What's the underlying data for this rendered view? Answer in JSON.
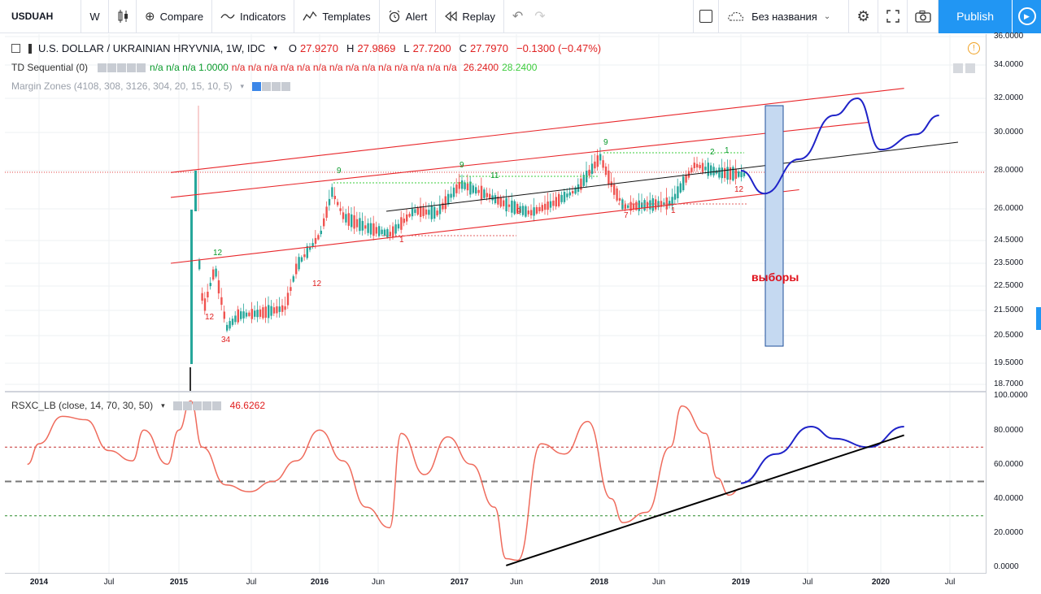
{
  "toolbar": {
    "symbol": "USDUAH",
    "interval": "W",
    "compare_label": "Compare",
    "indicators_label": "Indicators",
    "templates_label": "Templates",
    "alert_label": "Alert",
    "replay_label": "Replay",
    "layout_name": "Без названия",
    "publish_label": "Publish"
  },
  "legend": {
    "title": "U.S. DOLLAR / UKRAINIAN HRYVNIA, 1W, IDC",
    "o_label": "O",
    "o_value": "27.9270",
    "h_label": "H",
    "h_value": "27.9869",
    "l_label": "L",
    "l_value": "27.7200",
    "c_label": "C",
    "c_value": "27.7970",
    "change": "−0.1300 (−0.47%)",
    "td_name": "TD Sequential (0)",
    "td_values_green": "n/a n/a n/a 1.0000",
    "td_values_red": "n/a n/a n/a n/a n/a n/a n/a n/a n/a n/a n/a n/a n/a n/a",
    "td_val_1": "26.2400",
    "td_val_2": "28.2400",
    "mz_name": "Margin Zones (4108, 308, 3126, 304, 20, 15, 10, 5)",
    "rsx_name": "RSXC_LB (close, 14, 70, 30, 50)",
    "rsx_value": "46.6262"
  },
  "annotation": "выборы",
  "price_axis": [
    "36.0000",
    "34.0000",
    "32.0000",
    "30.0000",
    "28.0000",
    "26.0000",
    "24.5000",
    "23.5000",
    "22.5000",
    "21.5000",
    "20.5000",
    "19.5000",
    "18.7000"
  ],
  "osc_axis": [
    "100.0000",
    "80.0000",
    "60.0000",
    "40.0000",
    "20.0000",
    "0.0000"
  ],
  "time_axis": [
    {
      "label": "2014",
      "year": true
    },
    {
      "label": "Jul",
      "year": false
    },
    {
      "label": "2015",
      "year": true
    },
    {
      "label": "Jul",
      "year": false
    },
    {
      "label": "2016",
      "year": true
    },
    {
      "label": "Jun",
      "year": false
    },
    {
      "label": "2017",
      "year": true
    },
    {
      "label": "Jun",
      "year": false
    },
    {
      "label": "2018",
      "year": true
    },
    {
      "label": "Jun",
      "year": false
    },
    {
      "label": "2019",
      "year": true
    },
    {
      "label": "Jul",
      "year": false
    },
    {
      "label": "2020",
      "year": true
    },
    {
      "label": "Jul",
      "year": false
    }
  ],
  "colors": {
    "up_candle": "#26a69a",
    "down_candle": "#ef5350",
    "channel": "#e8262a",
    "forecast": "#1f23c8",
    "rsx_line": "#ef6b5c",
    "accent": "#2196f3"
  },
  "chart_data": [
    {
      "type": "candlestick",
      "title": "U.S. DOLLAR / UKRAINIAN HRYVNIA, 1W, IDC",
      "close_path": [
        [
          "2015-01",
          19.4
        ],
        [
          "2015-02",
          27.8
        ],
        [
          "2015-03",
          21.5
        ],
        [
          "2015-04",
          23.3
        ],
        [
          "2015-05",
          20.8
        ],
        [
          "2015-06",
          21.3
        ],
        [
          "2015-08",
          21.4
        ],
        [
          "2015-10",
          21.6
        ],
        [
          "2015-11",
          23.4
        ],
        [
          "2016-01",
          24.8
        ],
        [
          "2016-02",
          26.9
        ],
        [
          "2016-03",
          25.6
        ],
        [
          "2016-05",
          25.1
        ],
        [
          "2016-07",
          24.8
        ],
        [
          "2016-09",
          25.9
        ],
        [
          "2016-11",
          25.8
        ],
        [
          "2017-01",
          27.3
        ],
        [
          "2017-03",
          26.8
        ],
        [
          "2017-05",
          26.2
        ],
        [
          "2017-07",
          25.8
        ],
        [
          "2017-09",
          26.3
        ],
        [
          "2017-11",
          27.0
        ],
        [
          "2018-01",
          28.7
        ],
        [
          "2018-02",
          27.2
        ],
        [
          "2018-03",
          26.1
        ],
        [
          "2018-05",
          26.2
        ],
        [
          "2018-07",
          26.3
        ],
        [
          "2018-09",
          28.3
        ],
        [
          "2018-11",
          27.9
        ],
        [
          "2019-01",
          27.8
        ]
      ],
      "channel_lines": [
        {
          "from": [
            "2015-01",
            27.9
          ],
          "to": [
            "2020-03",
            32.6
          ]
        },
        {
          "from": [
            "2015-01",
            26.6
          ],
          "to": [
            "2019-12",
            30.6
          ]
        },
        {
          "from": [
            "2015-01",
            23.5
          ],
          "to": [
            "2019-06",
            27.0
          ]
        }
      ],
      "forecast": [
        [
          "2019-01",
          28.0
        ],
        [
          "2019-03",
          26.8
        ],
        [
          "2019-06",
          28.6
        ],
        [
          "2019-09",
          31.0
        ],
        [
          "2019-11",
          32.0
        ],
        [
          "2020-01",
          29.1
        ],
        [
          "2020-04",
          29.9
        ],
        [
          "2020-06",
          31.0
        ]
      ],
      "event_zone": {
        "from": "2019-03",
        "to": "2019-05",
        "label": "выборы"
      }
    },
    {
      "type": "line",
      "title": "RSXC_LB (close, 14, 70, 30, 50)",
      "ylim": [
        0,
        100
      ],
      "levels": [
        70,
        50,
        30
      ],
      "values": [
        [
          "2013-12",
          60
        ],
        [
          "2014-01",
          72
        ],
        [
          "2014-03",
          88
        ],
        [
          "2014-05",
          86
        ],
        [
          "2014-07",
          68
        ],
        [
          "2014-09",
          62
        ],
        [
          "2014-10",
          80
        ],
        [
          "2014-12",
          60
        ],
        [
          "2015-01",
          80
        ],
        [
          "2015-02",
          97
        ],
        [
          "2015-03",
          70
        ],
        [
          "2015-05",
          48
        ],
        [
          "2015-07",
          44
        ],
        [
          "2015-09",
          50
        ],
        [
          "2015-11",
          62
        ],
        [
          "2016-01",
          80
        ],
        [
          "2016-03",
          62
        ],
        [
          "2016-05",
          35
        ],
        [
          "2016-07",
          23
        ],
        [
          "2016-08",
          78
        ],
        [
          "2016-10",
          54
        ],
        [
          "2016-12",
          76
        ],
        [
          "2017-02",
          60
        ],
        [
          "2017-04",
          35
        ],
        [
          "2017-05",
          5
        ],
        [
          "2017-06",
          4
        ],
        [
          "2017-08",
          72
        ],
        [
          "2017-10",
          66
        ],
        [
          "2017-12",
          85
        ],
        [
          "2018-02",
          40
        ],
        [
          "2018-03",
          26
        ],
        [
          "2018-05",
          32
        ],
        [
          "2018-07",
          70
        ],
        [
          "2018-08",
          94
        ],
        [
          "2018-10",
          78
        ],
        [
          "2018-11",
          52
        ],
        [
          "2018-12",
          42
        ],
        [
          "2019-01",
          46
        ]
      ],
      "forecast": [
        [
          "2019-01",
          49
        ],
        [
          "2019-04",
          66
        ],
        [
          "2019-07",
          82
        ],
        [
          "2019-09",
          75
        ],
        [
          "2019-12",
          70
        ],
        [
          "2020-03",
          82
        ]
      ],
      "trendline": {
        "from": [
          "2017-05",
          1
        ],
        "to": [
          "2020-03",
          77
        ]
      }
    }
  ]
}
